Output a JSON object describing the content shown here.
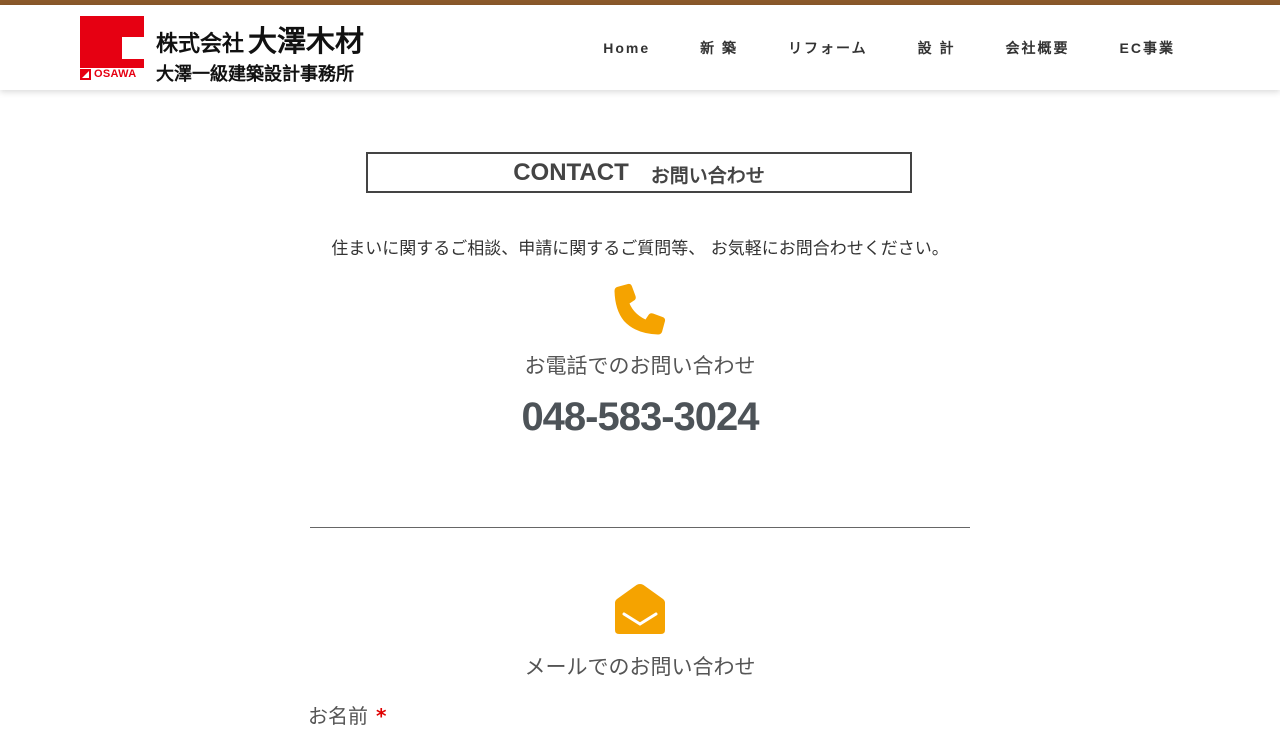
{
  "header": {
    "logo": {
      "company_prefix": "株式会社",
      "company_name": "大澤木材",
      "office_name": "大澤一級建築設計事務所",
      "brand_text": "OSAWA"
    },
    "nav": [
      {
        "label": "Home"
      },
      {
        "label": "新 築"
      },
      {
        "label": "リフォーム"
      },
      {
        "label": "設 計"
      },
      {
        "label": "会社概要"
      },
      {
        "label": "EC事業"
      }
    ]
  },
  "contact": {
    "title_en": "CONTACT",
    "title_ja": "お問い合わせ",
    "intro": "住まいに関するご相談、申請に関するご質問等、 お気軽にお問合わせください。"
  },
  "phone": {
    "icon": "phone-icon",
    "heading": "お電話でのお問い合わせ",
    "number": "048-583-3024"
  },
  "mail": {
    "icon": "envelope-icon",
    "heading": "メールでのお問い合わせ"
  },
  "form": {
    "name_label": "お名前",
    "required_mark": "*"
  },
  "colors": {
    "accent": "#f5a300",
    "brand_red": "#e60012",
    "top_strip": "#8b5a2b"
  }
}
